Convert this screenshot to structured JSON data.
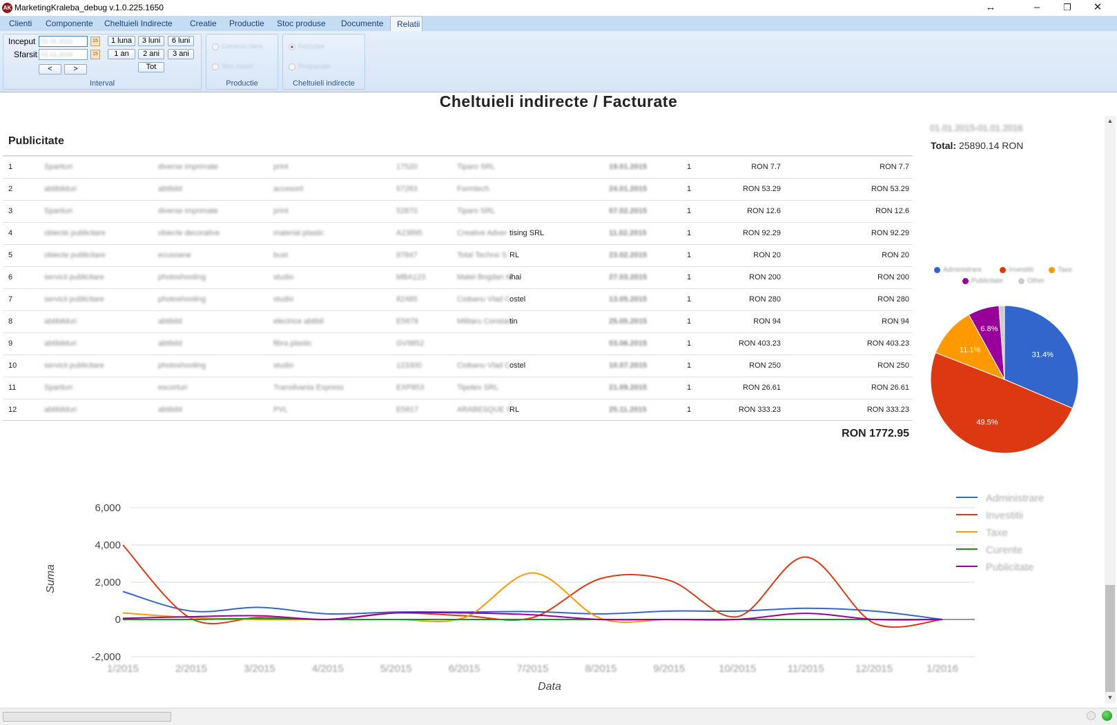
{
  "window": {
    "title": "MarketingKraleba_debug v.1.0.225.1650",
    "icon_text": "AK"
  },
  "menu": {
    "tabs": [
      "Clienti",
      "Componente",
      "Cheltuieli Indirecte",
      "Creatie",
      "Productie",
      "Stoc produse",
      "Documente",
      "Relatii"
    ],
    "active_tab": "Relatii"
  },
  "ribbon": {
    "interval": {
      "label": "Interval",
      "start_label": "Inceput",
      "end_label": "Sfarsit",
      "start_value": "01.01.2015",
      "end_value": "01.01.2016",
      "presets": [
        "1 luna",
        "3 luni",
        "6 luni",
        "1 an",
        "2 ani",
        "3 ani"
      ],
      "all_label": "Tot",
      "prev_label": "<",
      "next_label": ">"
    },
    "productie": {
      "label": "Productie",
      "options": [
        "Comenzi client",
        "Stoc curent"
      ]
    },
    "cheltuieli": {
      "label": "Cheltuieli indirecte",
      "options": [
        "Facturate",
        "Programate"
      ],
      "selected": "Facturate"
    }
  },
  "report": {
    "heading": "Cheltuieli indirecte / Facturate",
    "section": "Publicitate",
    "rows": [
      {
        "n": "1",
        "c1": "Spartiuri",
        "c2": "diverse imprimate",
        "c3": "print",
        "c4": "17520",
        "vendor_hidden": "Tiparo SRL",
        "vendor_visible": "",
        "date": "19.01.2015",
        "qty": "1",
        "price": "RON 7.7",
        "total": "RON 7.7"
      },
      {
        "n": "2",
        "c1": "abtibilduri",
        "c2": "abtibild",
        "c3": "accesorii",
        "c4": "57283",
        "vendor_hidden": "Formtech",
        "vendor_visible": "",
        "date": "24.01.2015",
        "qty": "1",
        "price": "RON 53.29",
        "total": "RON 53.29"
      },
      {
        "n": "3",
        "c1": "Spartiuri",
        "c2": "diverse imprimate",
        "c3": "print",
        "c4": "52870",
        "vendor_hidden": "Tiparo SRL",
        "vendor_visible": "",
        "date": "07.02.2015",
        "qty": "1",
        "price": "RON 12.6",
        "total": "RON 12.6"
      },
      {
        "n": "4",
        "c1": "obiecte publicitare",
        "c2": "obiecte decorative",
        "c3": "material plastic",
        "c4": "A23895",
        "vendor_hidden": "Creative Adver",
        "vendor_visible": "tising SRL",
        "date": "11.02.2015",
        "qty": "1",
        "price": "RON 92.29",
        "total": "RON 92.29"
      },
      {
        "n": "5",
        "c1": "obiecte publicitare",
        "c2": "ecusoane",
        "c3": "bust",
        "c4": "97847",
        "vendor_hidden": "Total Techno S",
        "vendor_visible": "RL",
        "date": "23.02.2015",
        "qty": "1",
        "price": "RON 20",
        "total": "RON 20"
      },
      {
        "n": "6",
        "c1": "servicii publicitare",
        "c2": "photoshooting",
        "c3": "studio",
        "c4": "MBA123",
        "vendor_hidden": "Matei Bogdan M",
        "vendor_visible": "ihai",
        "date": "27.03.2015",
        "qty": "1",
        "price": "RON 200",
        "total": "RON 200"
      },
      {
        "n": "7",
        "c1": "servicii publicitare",
        "c2": "photoshooting",
        "c3": "studio",
        "c4": "82485",
        "vendor_hidden": "Ciobanu Vlad C",
        "vendor_visible": "ostel",
        "date": "13.05.2015",
        "qty": "1",
        "price": "RON 280",
        "total": "RON 280"
      },
      {
        "n": "8",
        "c1": "abtibilduri",
        "c2": "abtibild",
        "c3": "electrice abtibil",
        "c4": "E5878",
        "vendor_hidden": "Militaru Constan",
        "vendor_visible": "tin",
        "date": "25.05.2015",
        "qty": "1",
        "price": "RON 94",
        "total": "RON 94"
      },
      {
        "n": "9",
        "c1": "abtibilduri",
        "c2": "abtibild",
        "c3": "fibra plastic",
        "c4": "GV9852",
        "vendor_hidden": "",
        "vendor_visible": "",
        "date": "03.06.2015",
        "qty": "1",
        "price": "RON 403.23",
        "total": "RON 403.23"
      },
      {
        "n": "10",
        "c1": "servicii publicitare",
        "c2": "photoshooting",
        "c3": "studio",
        "c4": "123300",
        "vendor_hidden": "Ciobanu Vlad C",
        "vendor_visible": "ostel",
        "date": "10.07.2015",
        "qty": "1",
        "price": "RON 250",
        "total": "RON 250"
      },
      {
        "n": "11",
        "c1": "Spartiuri",
        "c2": "escorturi",
        "c3": "Transilvania Express",
        "c4": "EXP853",
        "vendor_hidden": "Tipotex SRL",
        "vendor_visible": "",
        "date": "21.09.2015",
        "qty": "1",
        "price": "RON 26.61",
        "total": "RON 26.61"
      },
      {
        "n": "12",
        "c1": "abtibilduri",
        "c2": "abtibild",
        "c3": "PVL",
        "c4": "E5817",
        "vendor_hidden": "ARABESQUE S",
        "vendor_visible": "RL",
        "date": "25.11.2015",
        "qty": "1",
        "price": "RON 333.23",
        "total": "RON 333.23"
      }
    ],
    "grand_total": "RON 1772.95"
  },
  "summary": {
    "date_range": "01.01.2015-01.01.2016",
    "total_label": "Total:",
    "total_value": "25890.14 RON"
  },
  "pie": {
    "legend": [
      {
        "label": "Administrare",
        "color": "#3366cc"
      },
      {
        "label": "Investitii",
        "color": "#dc3912"
      },
      {
        "label": "Taxe",
        "color": "#ff9900"
      },
      {
        "label": "Publicitate",
        "color": "#990099"
      },
      {
        "label": "Other",
        "color": "#cccccc"
      }
    ],
    "slices": [
      {
        "label": "Administrare",
        "pct": 31.4,
        "text": "31.4%",
        "color": "#3366cc"
      },
      {
        "label": "Investitii",
        "pct": 49.5,
        "text": "49.5%",
        "color": "#dc3912"
      },
      {
        "label": "Taxe",
        "pct": 11.1,
        "text": "11.1%",
        "color": "#ff9900"
      },
      {
        "label": "Publicitate",
        "pct": 6.8,
        "text": "6.8%",
        "color": "#990099"
      },
      {
        "label": "Other",
        "pct": 1.2,
        "text": "",
        "color": "#cccccc"
      }
    ]
  },
  "chart_data": {
    "type": "line",
    "x": [
      "1/2015",
      "2/2015",
      "3/2015",
      "4/2015",
      "5/2015",
      "6/2015",
      "7/2015",
      "8/2015",
      "9/2015",
      "10/2015",
      "11/2015",
      "12/2015",
      "1/2016"
    ],
    "xlabel": "Data",
    "ylabel": "Suma",
    "ylim": [
      -2000,
      6000
    ],
    "yticks": [
      -2000,
      0,
      2000,
      4000,
      6000
    ],
    "ytick_labels": [
      "-2,000",
      "0",
      "2,000",
      "4,000",
      "6,000"
    ],
    "grid": true,
    "legend_position": "right",
    "series": [
      {
        "name": "Administrare",
        "color": "#3366cc",
        "values": [
          1500,
          450,
          650,
          300,
          400,
          400,
          420,
          300,
          450,
          450,
          600,
          450,
          0
        ]
      },
      {
        "name": "Investitii",
        "color": "#dc3912",
        "values": [
          4000,
          50,
          100,
          0,
          350,
          200,
          100,
          2200,
          2100,
          150,
          3350,
          -200,
          0
        ]
      },
      {
        "name": "Taxe",
        "color": "#ff9900",
        "values": [
          350,
          100,
          0,
          0,
          0,
          100,
          2500,
          50,
          0,
          0,
          0,
          0,
          0
        ]
      },
      {
        "name": "Curente",
        "color": "#109618",
        "values": [
          0,
          0,
          50,
          0,
          0,
          0,
          0,
          0,
          0,
          0,
          0,
          0,
          0
        ]
      },
      {
        "name": "Publicitate",
        "color": "#990099",
        "values": [
          60,
          150,
          200,
          0,
          350,
          350,
          250,
          0,
          0,
          0,
          330,
          0,
          0
        ]
      }
    ]
  }
}
